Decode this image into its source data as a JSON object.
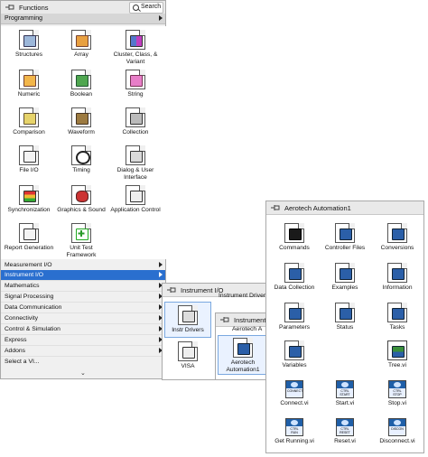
{
  "functions_palette": {
    "title": "Functions",
    "search_label": "Search",
    "programming_title": "Programming",
    "programming_items": [
      {
        "label": "Structures",
        "icon": "structures-icon"
      },
      {
        "label": "Array",
        "icon": "array-icon"
      },
      {
        "label": "Cluster, Class, & Variant",
        "icon": "cluster-icon"
      },
      {
        "label": "Numeric",
        "icon": "numeric-icon"
      },
      {
        "label": "Boolean",
        "icon": "boolean-icon"
      },
      {
        "label": "String",
        "icon": "string-icon"
      },
      {
        "label": "Comparison",
        "icon": "comparison-icon"
      },
      {
        "label": "Waveform",
        "icon": "waveform-icon"
      },
      {
        "label": "Collection",
        "icon": "collection-icon"
      },
      {
        "label": "File I/O",
        "icon": "file-io-icon"
      },
      {
        "label": "Timing",
        "icon": "timing-icon"
      },
      {
        "label": "Dialog & User Interface",
        "icon": "dialog-icon"
      },
      {
        "label": "Synchronization",
        "icon": "synchronization-icon"
      },
      {
        "label": "Graphics & Sound",
        "icon": "graphics-icon"
      },
      {
        "label": "Application Control",
        "icon": "application-control-icon"
      },
      {
        "label": "Report Generation",
        "icon": "report-icon"
      },
      {
        "label": "Unit Test Framework",
        "icon": "unit-test-icon"
      }
    ],
    "categories": [
      {
        "label": "Measurement I/O"
      },
      {
        "label": "Instrument I/O"
      },
      {
        "label": "Mathematics"
      },
      {
        "label": "Signal Processing"
      },
      {
        "label": "Data Communication"
      },
      {
        "label": "Connectivity"
      },
      {
        "label": "Control & Simulation"
      },
      {
        "label": "Express"
      },
      {
        "label": "Addons"
      },
      {
        "label": "Select a VI..."
      }
    ],
    "more_glyph": "⌄"
  },
  "instrument_io_palette": {
    "title": "Instrument I/O",
    "subtitle": "Instrument Drivers",
    "items": [
      {
        "label": "Instr Drivers",
        "glyph": "INSTR"
      },
      {
        "label": "VISA",
        "glyph": "VISA"
      }
    ]
  },
  "instrument_drivers_palette": {
    "title": "Instrument",
    "subtitle": "Aerotech A",
    "items": [
      {
        "label": "Aerotech Automation1"
      }
    ]
  },
  "aerotech_palette": {
    "title": "Aerotech Automation1",
    "folders": [
      {
        "label": "Commands"
      },
      {
        "label": "Controller Files"
      },
      {
        "label": "Conversions"
      },
      {
        "label": "Data Collection"
      },
      {
        "label": "Examples"
      },
      {
        "label": "Information"
      },
      {
        "label": "Parameters"
      },
      {
        "label": "Status"
      },
      {
        "label": "Tasks"
      },
      {
        "label": "Variables"
      },
      {
        "label": "Tree.vi"
      }
    ],
    "vis": [
      {
        "label": "Connect.vi",
        "glyph": "CONNECT"
      },
      {
        "label": "Start.vi",
        "glyph": "CTRL START"
      },
      {
        "label": "Stop.vi",
        "glyph": "CTRL STOP"
      },
      {
        "label": "Get Running.vi",
        "glyph": "CTRL RUN"
      },
      {
        "label": "Reset.vi",
        "glyph": "CTRL RESET"
      },
      {
        "label": "Disconnect.vi",
        "glyph": "DISCON"
      }
    ]
  },
  "colors": {
    "selection": "#2a6fcf",
    "vi_blue": "#1f5fa8"
  }
}
